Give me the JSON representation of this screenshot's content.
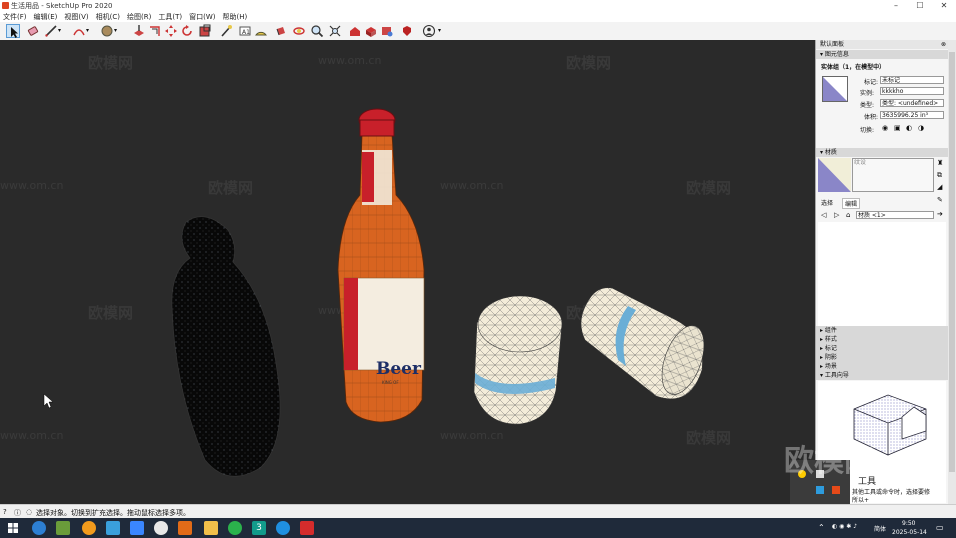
{
  "window": {
    "title": "生活用品 - SketchUp Pro 2020",
    "controls": [
      "–",
      "☐",
      "✕"
    ]
  },
  "menu": [
    "文件(F)",
    "编辑(E)",
    "视图(V)",
    "相机(C)",
    "绘图(R)",
    "工具(T)",
    "窗口(W)",
    "帮助(H)"
  ],
  "toolbar": {
    "tools": [
      "select-tool",
      "eraser-tool",
      "line-tool",
      "arc-tool",
      "shape-tool",
      "pushpull-tool",
      "offset-tool",
      "move-tool",
      "rotate-tool",
      "scale-tool",
      "tape-tool",
      "text-tool",
      "protractor-tool",
      "paint-tool",
      "orbit-tool",
      "pan-tool",
      "zoom-tool",
      "zoom-extents-tool",
      "warehouse-tool",
      "extension-warehouse-tool",
      "components-tool",
      "ruby-tool",
      "account-tool"
    ]
  },
  "viewport": {
    "watermark_text": "欧模网",
    "watermark_url": "www.om.cn",
    "bottle_label": "Beer",
    "bottle_sublabel": "KING OF"
  },
  "panel": {
    "title": "默认面板",
    "entity_info": {
      "header": "图元信息",
      "entity_name": "实体组（1，在模型中）",
      "tag_label": "标记:",
      "tag_value": "未标记",
      "instance_label": "实例:",
      "instance_value": "kkkkho",
      "type_label": "类型:",
      "type_value": "类型: <undefined>",
      "volume_label": "体积:",
      "volume_value": "3635996.25 in³",
      "toggles_label": "切换:"
    },
    "materials": {
      "header": "材质",
      "material_name": "纹设",
      "tab_select": "选择",
      "tab_edit": "编辑",
      "library_value": "材质 <1>"
    },
    "collapsed": [
      "组件",
      "样式",
      "标记",
      "阴影",
      "场景",
      "工具向导"
    ],
    "instructor": {
      "title": "工具",
      "text": "其他工具或命令时，选择要修",
      "text2": "所以+"
    }
  },
  "status": {
    "text": "选择对象。切换到扩充选择。拖动鼠标选择多项。"
  },
  "taskbar": {
    "lang": "简体",
    "time": "9:50",
    "date": "2025-05-14",
    "notify_count": "3"
  },
  "colors": {
    "viewport_bg": "#2a2a2a",
    "bottle_orange": "#d86420",
    "cap_red": "#c8202a",
    "stripe_blue": "#6aaed6",
    "taskbar_bg": "#1f2a3a"
  }
}
